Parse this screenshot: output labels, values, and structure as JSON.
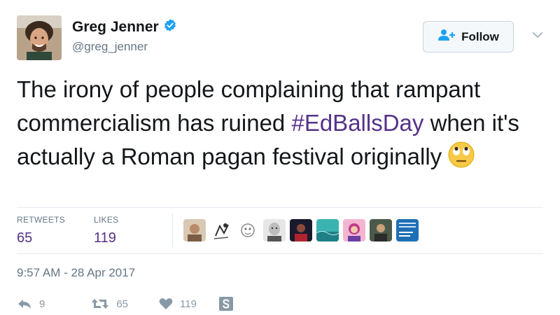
{
  "tweet": {
    "author": {
      "display_name": "Greg Jenner",
      "handle": "@greg_jenner",
      "verified": true
    },
    "follow_button_label": "Follow",
    "text_before_hashtag": "The irony of people complaining that rampant commercialism has ruined ",
    "hashtag": "#EdBallsDay",
    "text_after_hashtag": " when it's actually a Roman pagan festival originally",
    "emoji": "face-with-rolling-eyes",
    "stats": {
      "retweets_label": "RETWEETS",
      "retweets_count": "65",
      "likes_label": "LIKES",
      "likes_count": "119"
    },
    "timestamp": "9:57 AM - 28 Apr 2017",
    "actions": {
      "reply_count": "9",
      "retweet_count": "65",
      "like_count": "119"
    }
  },
  "colors": {
    "hashtag": "#553289",
    "verified_badge": "#1da1f2",
    "muted_text": "#657786",
    "action_icon": "#8899a6"
  }
}
